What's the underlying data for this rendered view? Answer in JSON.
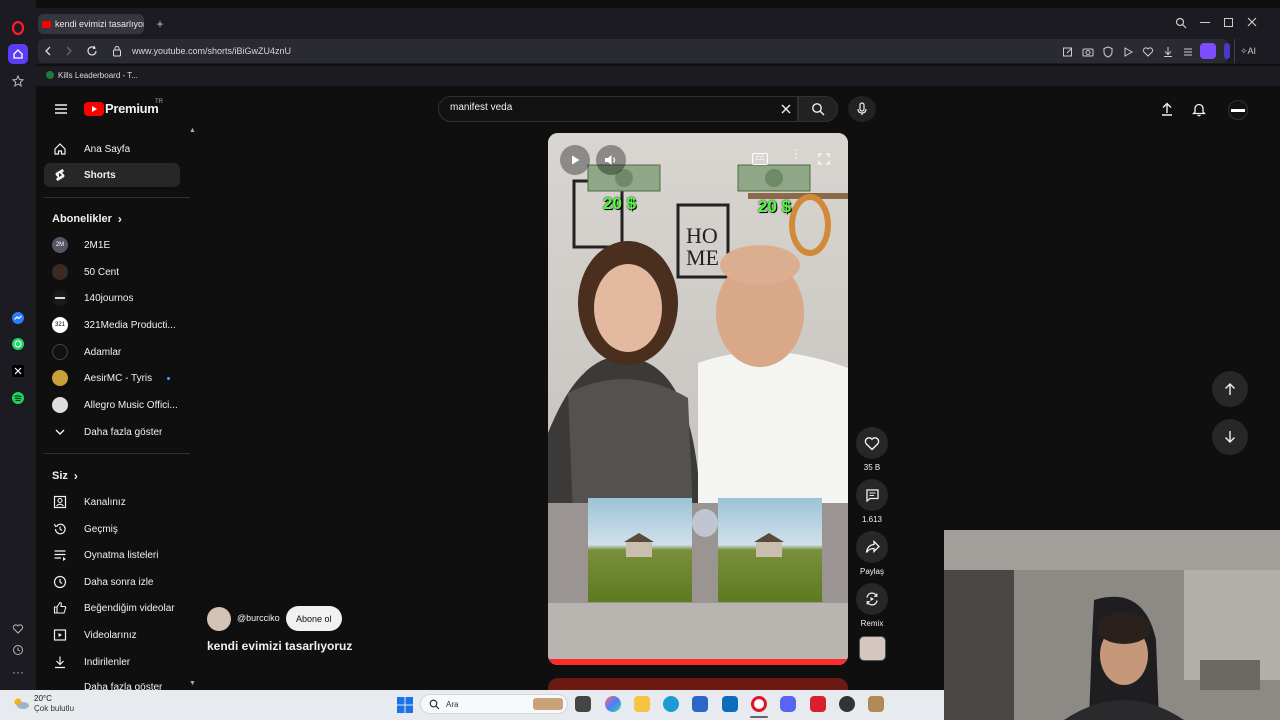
{
  "browser": {
    "tab_title": "kendi evimizi tasarlıyoruz",
    "url": "www.youtube.com/shorts/iBiGwZU4znU",
    "bookmark": "Kills Leaderboard - T...",
    "ai_label": "AI"
  },
  "youtube": {
    "brand": "Premium",
    "brand_sup": "TR",
    "search_value": "manifest veda",
    "sidebar": {
      "main": [
        {
          "label": "Ana Sayfa"
        },
        {
          "label": "Shorts"
        }
      ],
      "subs_heading": "Abonelikler",
      "subs": [
        {
          "label": "2M1E",
          "avatar": "2M"
        },
        {
          "label": "50 Cent",
          "avatar": ""
        },
        {
          "label": "140journos",
          "avatar": ""
        },
        {
          "label": "321Media Producti...",
          "avatar": "321"
        },
        {
          "label": "Adamlar",
          "avatar": ""
        },
        {
          "label": "AesirMC - Tyris",
          "avatar": ""
        },
        {
          "label": "Allegro Music Offici...",
          "avatar": ""
        }
      ],
      "show_more": "Daha fazla göster",
      "you_heading": "Siz",
      "you": [
        {
          "label": "Kanalınız"
        },
        {
          "label": "Geçmiş"
        },
        {
          "label": "Oynatma listeleri"
        },
        {
          "label": "Daha sonra izle"
        },
        {
          "label": "Beğendiğim videolar"
        },
        {
          "label": "Videolarınız"
        },
        {
          "label": "İndirilenler"
        },
        {
          "label": "Daha fazla göster"
        }
      ]
    },
    "short": {
      "channel": "@burcciko",
      "subscribe": "Abone ol",
      "title": "kendi evimizi tasarlıyoruz",
      "overlay_price_left": "20 $",
      "overlay_price_right": "20 $",
      "likes": "35 B",
      "comments": "1.613",
      "share": "Paylaş",
      "remix": "Remix"
    }
  },
  "taskbar": {
    "weather_temp": "20°C",
    "weather_desc": "Çok bulutlu",
    "search_placeholder": "Ara"
  }
}
